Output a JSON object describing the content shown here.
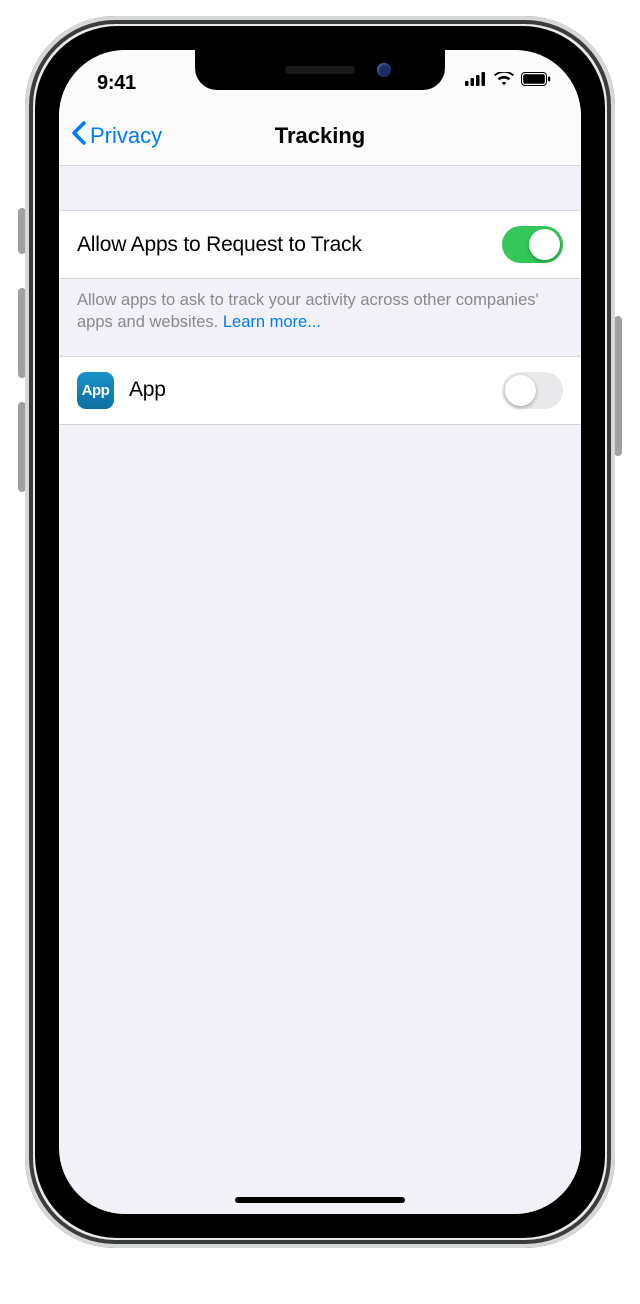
{
  "status_bar": {
    "time": "9:41"
  },
  "nav": {
    "back_label": "Privacy",
    "title": "Tracking"
  },
  "allow_cell": {
    "label": "Allow Apps to Request to Track",
    "enabled": true
  },
  "explainer": {
    "text": "Allow apps to ask to track your activity across other companies' apps and websites. ",
    "link_text": "Learn more..."
  },
  "apps": [
    {
      "icon_label": "App",
      "name": "App",
      "enabled": false
    }
  ]
}
